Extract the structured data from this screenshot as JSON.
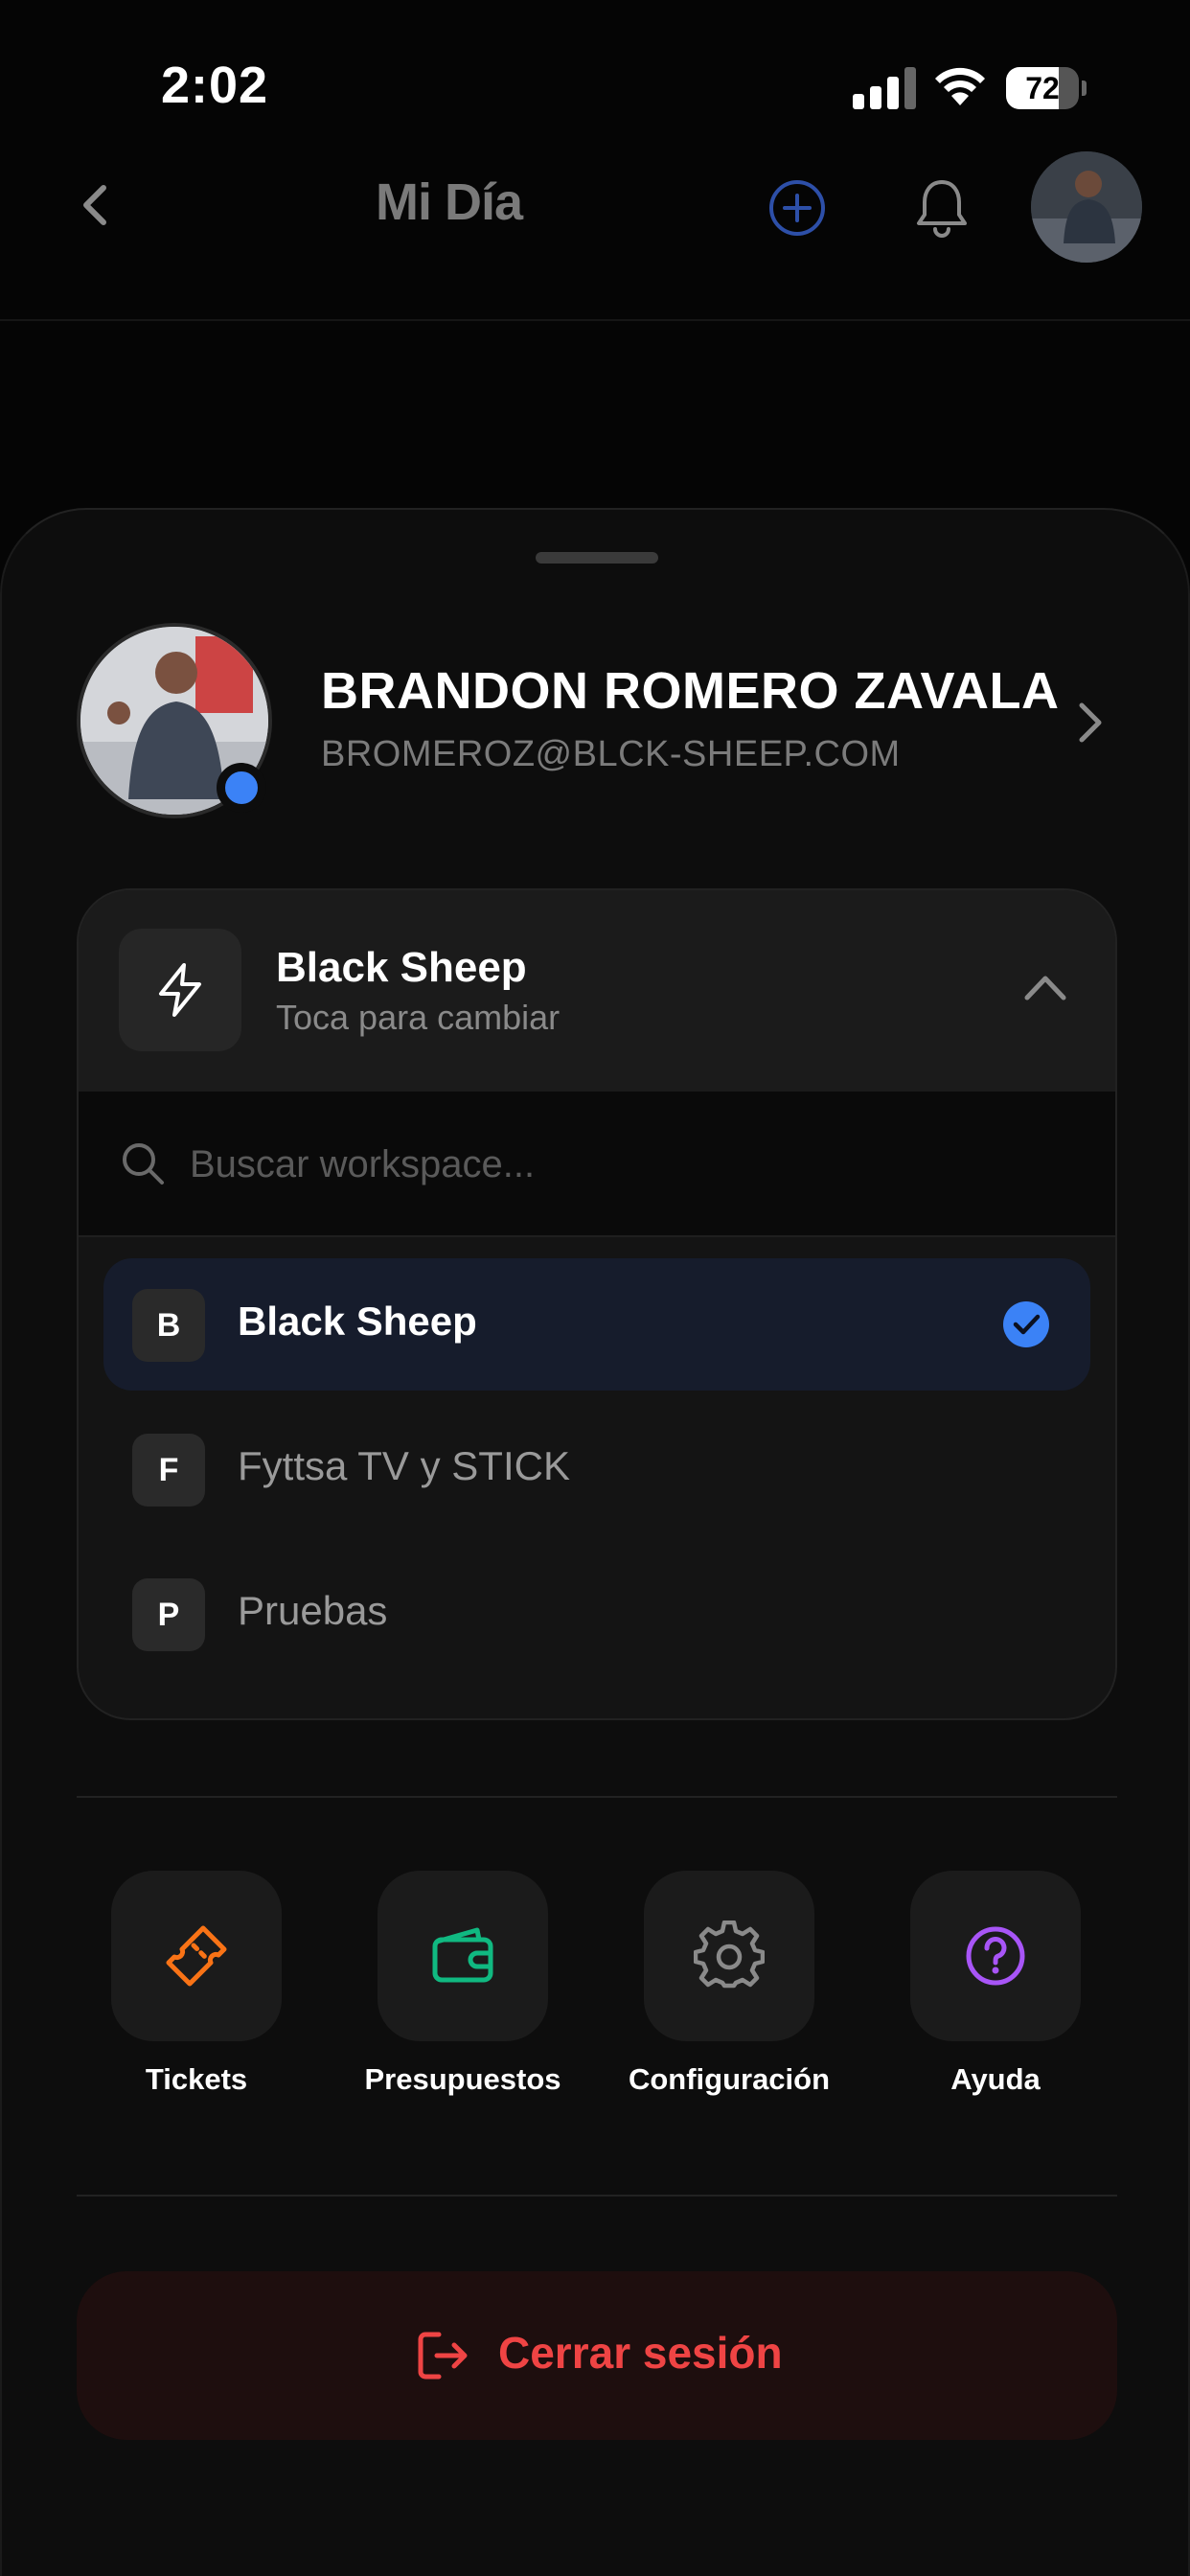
{
  "status_bar": {
    "time": "2:02",
    "battery": "72",
    "battery_level_percent": 72
  },
  "header": {
    "title": "Mi Día"
  },
  "profile": {
    "name": "BRANDON ROMERO ZAVALA",
    "email": "BROMEROZ@BLCK-SHEEP.COM"
  },
  "workspace": {
    "current_name": "Black Sheep",
    "subtitle": "Toca para cambiar",
    "search_placeholder": "Buscar workspace...",
    "items": [
      {
        "letter": "B",
        "label": "Black Sheep",
        "selected": true
      },
      {
        "letter": "F",
        "label": "Fyttsa TV y STICK",
        "selected": false
      },
      {
        "letter": "P",
        "label": "Pruebas",
        "selected": false
      }
    ]
  },
  "actions": [
    {
      "label": "Tickets",
      "icon": "ticket-icon",
      "color": "#f97316"
    },
    {
      "label": "Presupuestos",
      "icon": "wallet-icon",
      "color": "#10b981"
    },
    {
      "label": "Configuración",
      "icon": "gear-icon",
      "color": "#8a8a8a"
    },
    {
      "label": "Ayuda",
      "icon": "help-icon",
      "color": "#a855f7"
    }
  ],
  "logout": {
    "label": "Cerrar sesión",
    "color": "#ef4444"
  },
  "colors": {
    "accent": "#3b82f6",
    "background": "#0d0d0d"
  }
}
